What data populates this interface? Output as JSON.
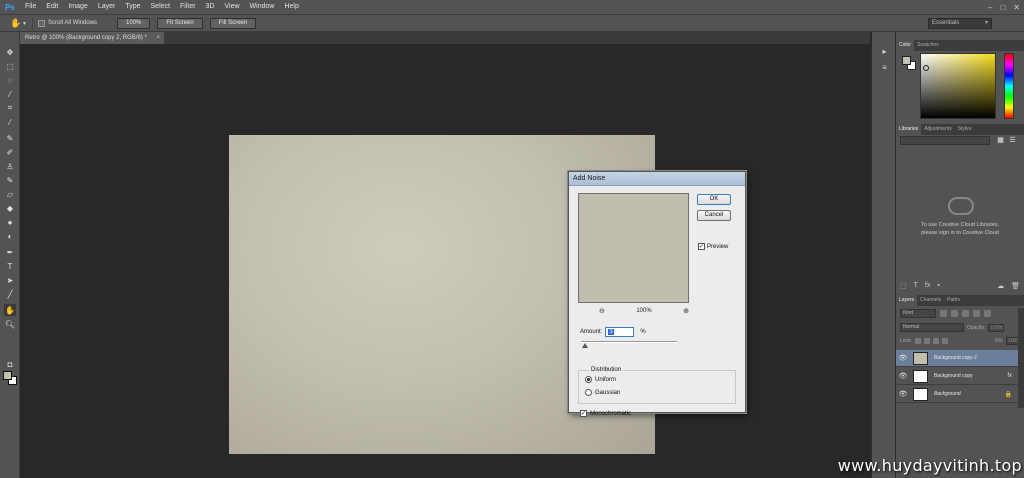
{
  "app": {
    "logo": "Ps",
    "menu": [
      "File",
      "Edit",
      "Image",
      "Layer",
      "Type",
      "Select",
      "Filter",
      "3D",
      "View",
      "Window",
      "Help"
    ],
    "window_controls": [
      "–",
      "□",
      "✕"
    ]
  },
  "options_bar": {
    "scroll_all_windows": "Scroll All Windows",
    "buttons": [
      "100%",
      "Fit Screen",
      "Fill Screen"
    ],
    "workspace": "Essentials"
  },
  "document_tab": {
    "title": "Retro @ 100% (Background copy 2, RGB/8) *",
    "close": "×"
  },
  "canvas": {
    "color": "#c3bfb0"
  },
  "dialog": {
    "title": "Add Noise",
    "ok": "OK",
    "cancel": "Cancel",
    "preview_label": "Preview",
    "preview_checked": true,
    "zoom_out": "⊖",
    "zoom_in": "⊕",
    "zoom_level": "100%",
    "amount_label": "Amount:",
    "amount_value": "3",
    "amount_unit": "%",
    "distribution_label": "Distribution",
    "uniform_label": "Uniform",
    "gaussian_label": "Gaussian",
    "distribution_selected": "Uniform",
    "monochromatic_label": "Monochromatic",
    "monochromatic_checked": true
  },
  "color_panel": {
    "tabs": [
      "Color",
      "Swatches"
    ],
    "foreground": "#c5c2b3",
    "background": "#ffffff"
  },
  "libraries_panel": {
    "tabs": [
      "Libraries",
      "Adjustments",
      "Styles"
    ],
    "message_line1": "To use Creative Cloud Libraries,",
    "message_line2": "please sign in to Creative Cloud"
  },
  "layers_panel": {
    "tabs": [
      "Layers",
      "Channels",
      "Paths"
    ],
    "kind": "Kind",
    "blend_mode": "Normal",
    "opacity_label": "Opacity:",
    "opacity_value": "100%",
    "lock_label": "Lock:",
    "fill_label": "Fill:",
    "fill_value": "100%",
    "layers": [
      {
        "name": "Background copy 2",
        "selected": true,
        "badge": ""
      },
      {
        "name": "Background copy",
        "selected": false,
        "badge": "fx"
      },
      {
        "name": "Background",
        "selected": false,
        "badge": "🔒"
      }
    ]
  },
  "watermark": "www.huydayvitinh.top"
}
